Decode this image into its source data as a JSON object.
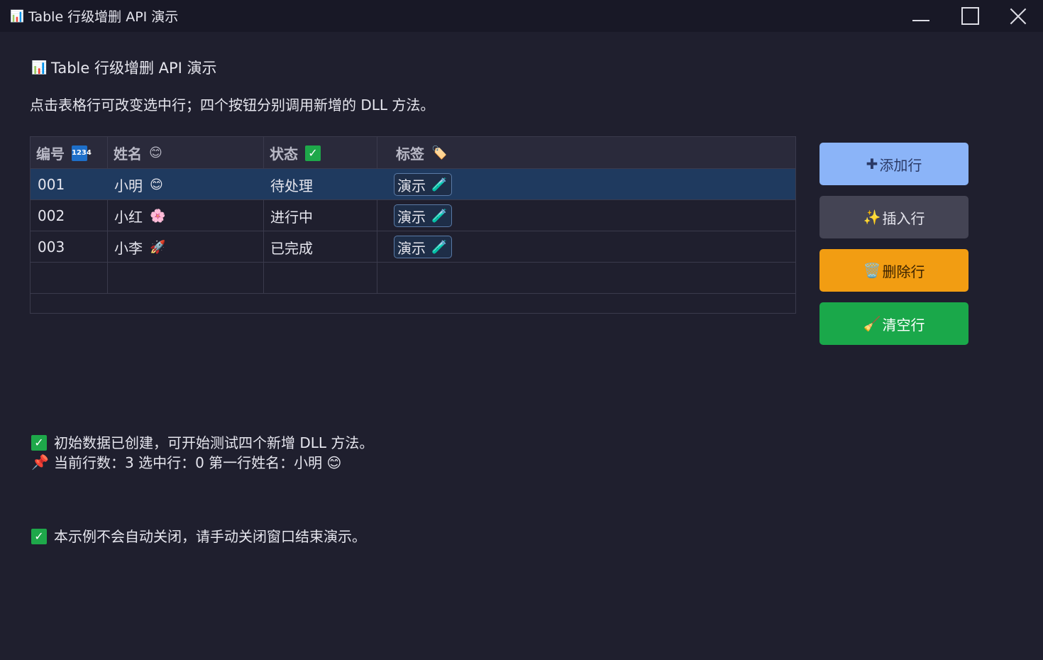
{
  "window": {
    "title": "Table 行级增删 API 演示",
    "icon": "bar-chart-icon"
  },
  "heading": "Table 行级增删 API 演示",
  "description": "点击表格行可改变选中行；四个按钮分别调用新增的 DLL 方法。",
  "table": {
    "columns": [
      "编号",
      "姓名",
      "状态",
      "标签"
    ],
    "column_icons": [
      "numbers-icon",
      "smile-icon",
      "check-icon",
      "tag-icon"
    ],
    "rows": [
      {
        "id": "001",
        "name": "小明",
        "name_icon": "😊",
        "status": "待处理",
        "tag": "演示",
        "selected": true
      },
      {
        "id": "002",
        "name": "小红",
        "name_icon": "🌸",
        "status": "进行中",
        "tag": "演示",
        "selected": false
      },
      {
        "id": "003",
        "name": "小李",
        "name_icon": "🚀",
        "status": "已完成",
        "tag": "演示",
        "selected": false
      }
    ]
  },
  "buttons": {
    "add": "添加行",
    "insert": "插入行",
    "delete": "删除行",
    "clear": "清空行"
  },
  "status": {
    "line1": "初始数据已创建，可开始测试四个新增 DLL 方法。",
    "line2": "当前行数：3  选中行：0  第一行姓名：小明 😊",
    "line3": "本示例不会自动关闭，请手动关闭窗口结束演示。"
  },
  "colors": {
    "background": "#1f1f2e",
    "selected_row": "#1f3a5f",
    "add_button": "#8bb4f8",
    "insert_button": "#444454",
    "delete_button": "#f29d12",
    "clear_button": "#1aa84a"
  }
}
